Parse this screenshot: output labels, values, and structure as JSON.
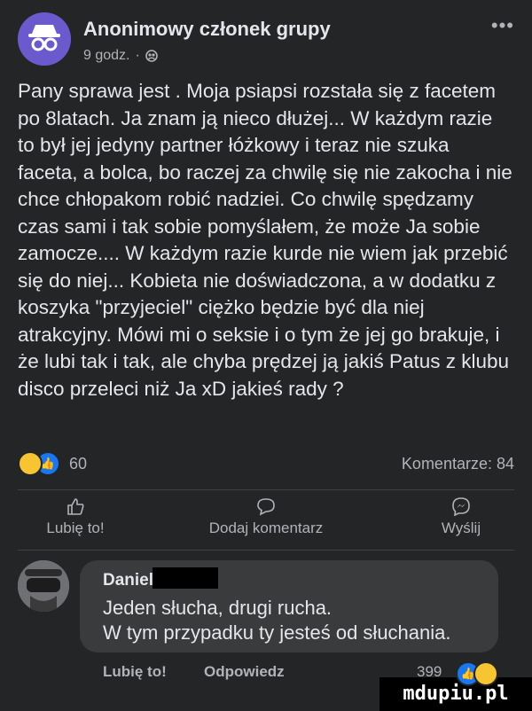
{
  "post": {
    "author": "Anonimowy członek grupy",
    "time": "9 godz.",
    "separator": "·",
    "more_label": "•••",
    "text": "Pany sprawa jest . Moja psiapsi rozstała się z facetem po 8latach. Ja znam ją nieco dłużej... W każdym razie to był jej jedyny partner łóżkowy i teraz nie szuka faceta, a bolca, bo raczej za chwilę się nie zakocha i nie chce chłopakom robić nadziei. Co chwilę spędzamy czas sami i tak sobie pomyślałem, że może Ja sobie zamocze.... W każdym razie kurde nie wiem jak przebić się do niej... Kobieta nie doświadczona, a w dodatku z koszyka \"przyjeciel\" ciężko będzie być dla niej atrakcyjny. Mówi mi o seksie i o tym że jej go brakuje, i że lubi tak i tak, ale chyba prędzej ją jakiś Patus z klubu disco przeleci niż Ja xD jakieś rady ?",
    "reaction_count": "60",
    "comments_label": "Komentarze: 84"
  },
  "actions": {
    "like": "Lubię to!",
    "comment": "Dodaj komentarz",
    "share": "Wyślij"
  },
  "comment": {
    "author": "Daniel",
    "text": "Jeden słucha, drugi rucha.\nW tym przypadku ty jesteś od słuchania.",
    "like_label": "Lubię to!",
    "reply_label": "Odpowiedz",
    "reaction_count": "399"
  },
  "watermark": "mdupiu.pl",
  "colors": {
    "background": "#242526",
    "bubble": "#3a3b3c",
    "text": "#e4e6eb",
    "secondary": "#b0b3b8",
    "like_blue": "#1877f2",
    "haha_yellow": "#f7c531"
  }
}
